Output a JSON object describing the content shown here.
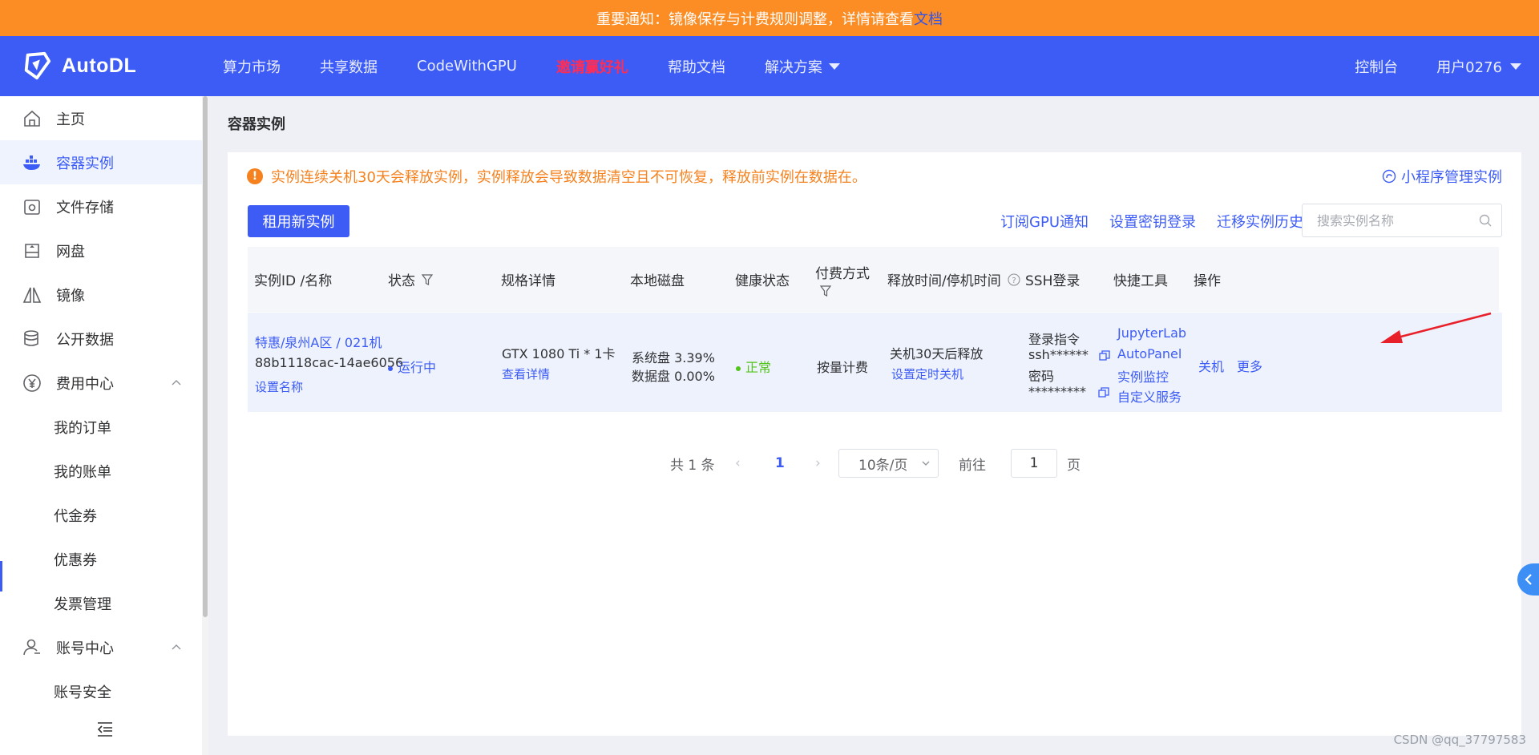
{
  "notice": {
    "text": "重要通知：镜像保存与计费规则调整，详情请查看",
    "link": "文档"
  },
  "header": {
    "logo": "AutoDL",
    "nav": [
      "算力市场",
      "共享数据",
      "CodeWithGPU",
      "邀请赢好礼",
      "帮助文档",
      "解决方案"
    ],
    "console": "控制台",
    "user": "用户0276"
  },
  "sidebar": {
    "items": [
      {
        "label": "主页",
        "icon": "home-icon"
      },
      {
        "label": "容器实例",
        "icon": "docker-icon"
      },
      {
        "label": "文件存储",
        "icon": "storage-icon"
      },
      {
        "label": "网盘",
        "icon": "disk-icon"
      },
      {
        "label": "镜像",
        "icon": "image-icon"
      },
      {
        "label": "公开数据",
        "icon": "database-icon"
      },
      {
        "label": "费用中心",
        "icon": "yen-icon"
      },
      {
        "label": "我的订单"
      },
      {
        "label": "我的账单"
      },
      {
        "label": "代金券"
      },
      {
        "label": "优惠券"
      },
      {
        "label": "发票管理"
      },
      {
        "label": "账号中心",
        "icon": "user-icon"
      },
      {
        "label": "账号安全"
      }
    ]
  },
  "main": {
    "title": "容器实例",
    "warning": "实例连续关机30天会释放实例，实例释放会导致数据清空且不可恢复，释放前实例在数据在。",
    "mini_program": "小程序管理实例",
    "new_instance": "租用新实例",
    "links": [
      "订阅GPU通知",
      "设置密钥登录",
      "迁移实例历史"
    ],
    "search_placeholder": "搜索实例名称",
    "columns": [
      "实例ID /名称",
      "状态",
      "规格详情",
      "本地磁盘",
      "健康状态",
      "付费方式",
      "释放时间/停机时间",
      "SSH登录",
      "快捷工具",
      "操作"
    ],
    "row": {
      "name": "特惠/泉州A区 / 021机",
      "id": "88b1118cac-14ae6056",
      "set_name": "设置名称",
      "status": "运行中",
      "spec": "GTX 1080 Ti * 1卡",
      "spec_detail": "查看详情",
      "disk_system": "系统盘 3.39%",
      "disk_data": "数据盘 0.00%",
      "health": "正常",
      "billing": "按量计费",
      "release": "关机30天后释放",
      "set_shutdown": "设置定时关机",
      "ssh_cmd_label": "登录指令",
      "ssh_cmd": "ssh******",
      "ssh_pwd_label": "密码",
      "ssh_pwd": "*********",
      "tools": [
        "JupyterLab",
        "AutoPanel",
        "实例监控",
        "自定义服务"
      ],
      "ops": [
        "关机",
        "更多"
      ]
    },
    "pager": {
      "total": "共 1 条",
      "page": "1",
      "size": "10条/页",
      "goto": "前往",
      "goto_value": "1",
      "page_unit": "页"
    }
  },
  "watermark": "CSDN @qq_37797583",
  "colors": {
    "primary": "#3d5cf5",
    "notice": "#fb8d24",
    "warning": "#f5821f",
    "success": "#52c41a",
    "invite": "#ff2d55",
    "annotation": "#e8202a"
  }
}
